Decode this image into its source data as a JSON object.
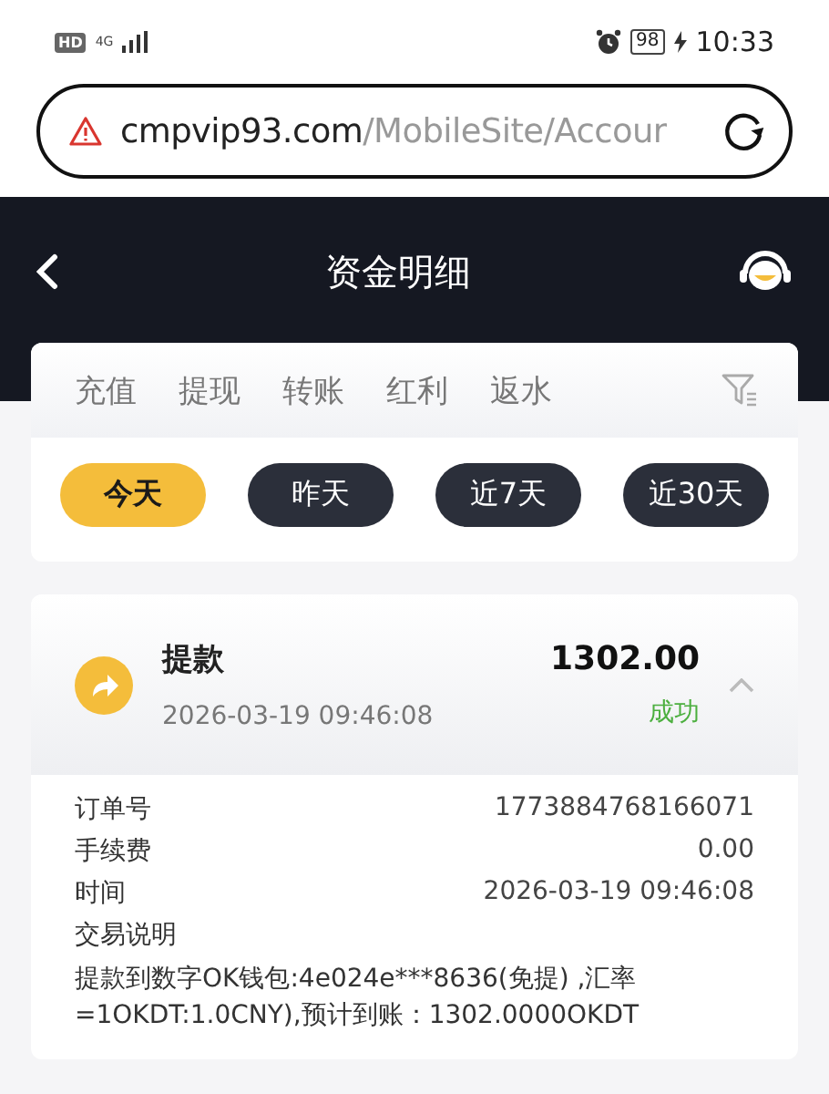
{
  "status_bar": {
    "hd": "HD",
    "network": "4G",
    "battery": "98",
    "time": "10:33"
  },
  "address_bar": {
    "domain": "cmpvip93.com",
    "path": "/MobileSite/Accour"
  },
  "header": {
    "title": "资金明细"
  },
  "tabs": [
    {
      "label": "充值",
      "selected": false
    },
    {
      "label": "提现",
      "selected": false
    },
    {
      "label": "转账",
      "selected": false
    },
    {
      "label": "红利",
      "selected": false
    },
    {
      "label": "返水",
      "selected": false
    }
  ],
  "date_filters": [
    {
      "label": "今天",
      "selected": true
    },
    {
      "label": "昨天",
      "selected": false
    },
    {
      "label": "近7天",
      "selected": false
    },
    {
      "label": "近30天",
      "selected": false
    }
  ],
  "record": {
    "title": "提款",
    "time": "2026-03-19 09:46:08",
    "amount": "1302.00",
    "status": "成功",
    "expanded": true,
    "details": [
      {
        "label": "订单号",
        "value": "1773884768166071"
      },
      {
        "label": "手续费",
        "value": "0.00"
      },
      {
        "label": "时间",
        "value": "2026-03-19 09:46:08"
      }
    ],
    "note_label": "交易说明",
    "note": "提款到数字OK钱包:4e024e***8636(免提) ,汇率=1OKDT:1.0CNY),预计到账：1302.0000OKDT"
  }
}
